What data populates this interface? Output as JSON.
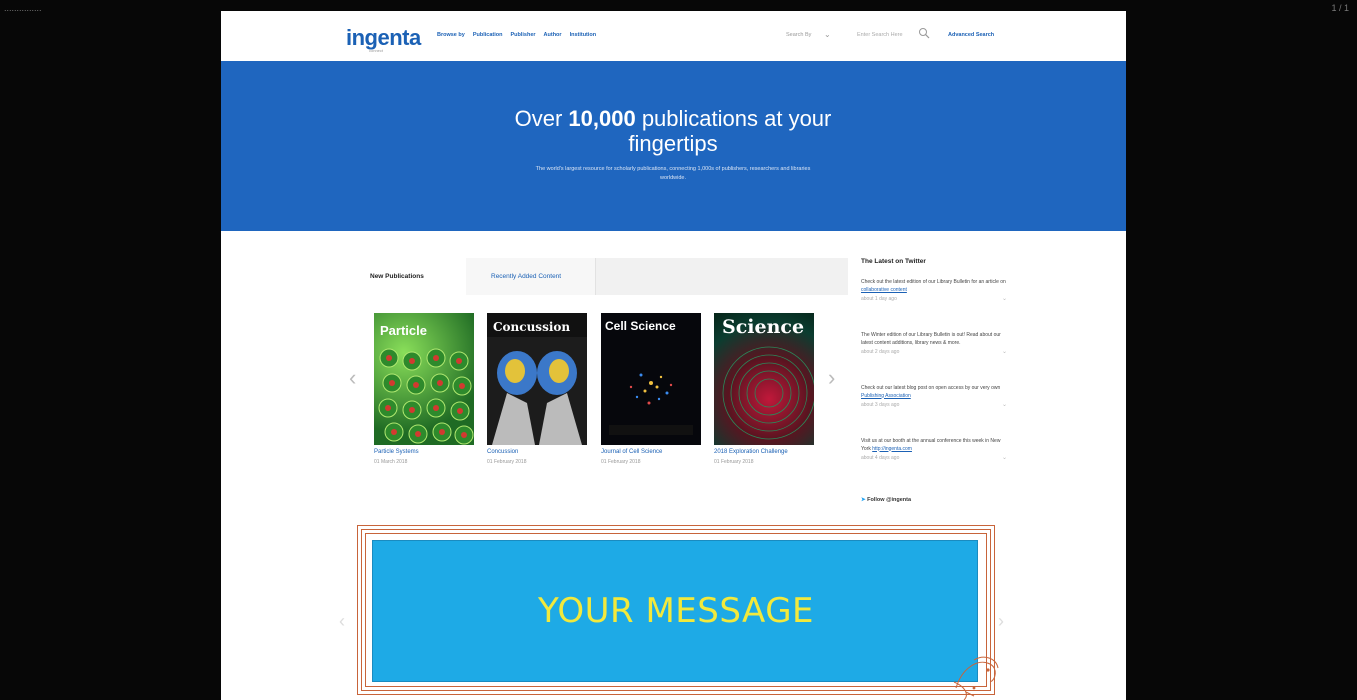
{
  "viewer": {
    "title": "...............",
    "count": "1 / 1"
  },
  "header": {
    "logo": "ingenta",
    "logo_sub": "connect",
    "nav": [
      "Browse by",
      "Publication",
      "Publisher",
      "Author",
      "Institution"
    ],
    "search_by": "Search By",
    "search_placeholder": "Enter Search Here",
    "advanced_search": "Advanced Search"
  },
  "hero": {
    "title_pre": "Over ",
    "title_bold": "10,000",
    "title_post": " publications at your fingertips",
    "subtitle": "The world's largest resource for scholarly publications, connecting 1,000s of publishers, researchers and libraries worldwide."
  },
  "tabs": {
    "active": "New Publications",
    "recent": "Recently Added Content"
  },
  "publications": [
    {
      "cover_title": "Particle",
      "name": "Particle Systems",
      "date": "01 March 2018"
    },
    {
      "cover_title": "Concussion",
      "name": "Concussion",
      "date": "01 February 2018"
    },
    {
      "cover_title": "Cell Science",
      "name": "Journal of Cell Science",
      "date": "01 February 2018"
    },
    {
      "cover_title": "Science",
      "name": "2018 Exploration Challenge",
      "date": "01 February 2018"
    }
  ],
  "twitter": {
    "title": "The Latest on Twitter",
    "tweets": [
      {
        "text": "Check out the latest edition of our Library Bulletin for an article on ",
        "link": "collaborative content",
        "date": "about 1 day ago"
      },
      {
        "text": "The Winter edition of our Library Bulletin is out! Read about our latest content additions, library news & more.",
        "link": "",
        "date": "about 2 days ago"
      },
      {
        "text": "Check out our latest blog post on open access by our very own ",
        "link": "Publishing Association",
        "date": "about 3 days ago"
      },
      {
        "text": "Visit us at our booth at the annual conference this week in New York ",
        "link": "http://ingenta.com",
        "date": "about 4 days ago"
      }
    ],
    "follow": "Follow @ingenta"
  },
  "message": {
    "text": "YOUR MESSAGE"
  },
  "colors": {
    "brand_blue": "#1f66bf",
    "message_bg": "#1eaae6",
    "message_text": "#f2e93c",
    "frame": "#c8643a"
  }
}
